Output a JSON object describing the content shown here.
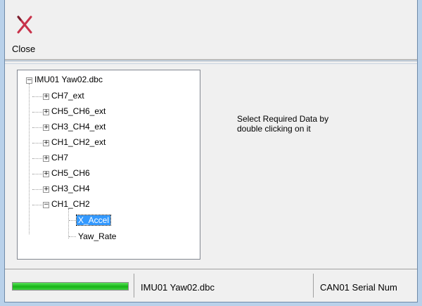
{
  "toolbar": {
    "close_label": "Close",
    "close_icon": "close-icon",
    "close_color": "#c8324a"
  },
  "tree": {
    "root": "IMU01 Yaw02.dbc",
    "nodes": [
      {
        "label": "CH7_ext",
        "expander": "+"
      },
      {
        "label": "CH5_CH6_ext",
        "expander": "+"
      },
      {
        "label": "CH3_CH4_ext",
        "expander": "+"
      },
      {
        "label": "CH1_CH2_ext",
        "expander": "+"
      },
      {
        "label": "CH7",
        "expander": "+"
      },
      {
        "label": "CH5_CH6",
        "expander": "+"
      },
      {
        "label": "CH3_CH4",
        "expander": "+"
      },
      {
        "label": "CH1_CH2",
        "expander": "−"
      }
    ],
    "children": [
      {
        "label": "X_Accel",
        "selected": true
      },
      {
        "label": "Yaw_Rate",
        "selected": false
      }
    ]
  },
  "hint": {
    "line1": "Select Required Data by",
    "line2": "double clicking on it"
  },
  "status": {
    "progress": 1.0,
    "progress_color": "#17b317",
    "file": "IMU01 Yaw02.dbc",
    "serial": "CAN01 Serial Num"
  }
}
